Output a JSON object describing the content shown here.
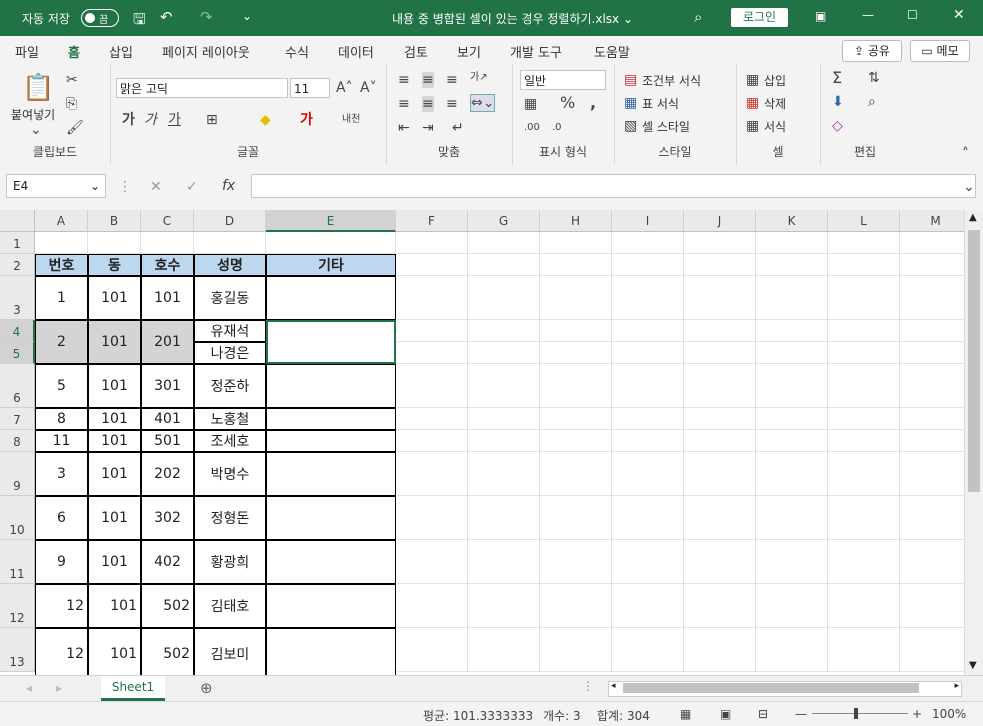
{
  "titlebar": {
    "autosave": "자동 저장",
    "toggle": "끔",
    "filename": "내용 중 병합된 셀이 있는 경우 정렬하기.xlsx",
    "login": "로그인"
  },
  "tabs": [
    "파일",
    "홈",
    "삽입",
    "페이지 레이아웃",
    "수식",
    "데이터",
    "검토",
    "보기",
    "개발 도구",
    "도움말"
  ],
  "share": "공유",
  "memo": "메모",
  "ribbon": {
    "clipboard": {
      "paste": "붙여넣기",
      "label": "클립보드"
    },
    "font": {
      "name": "맑은 고딕",
      "size": "11",
      "label": "글꼴"
    },
    "align": {
      "label": "맞춤"
    },
    "number": {
      "format": "일반",
      "label": "표시 형식"
    },
    "styles": {
      "cond": "조건부 서식",
      "table": "표 서식",
      "cell": "셀 스타일",
      "label": "스타일"
    },
    "cells": {
      "insert": "삽입",
      "delete": "삭제",
      "format": "서식",
      "label": "셀"
    },
    "edit": {
      "label": "편집"
    }
  },
  "namebox": "E4",
  "columns": [
    "A",
    "B",
    "C",
    "D",
    "E",
    "F",
    "G",
    "H",
    "I",
    "J",
    "K",
    "L",
    "M"
  ],
  "rows": [
    "1",
    "2",
    "3",
    "4",
    "5",
    "6",
    "7",
    "8",
    "9",
    "10",
    "11",
    "12",
    "13"
  ],
  "table": {
    "headers": [
      "번호",
      "동",
      "호수",
      "성명",
      "기타"
    ],
    "data": [
      [
        "1",
        "101",
        "101",
        "홍길동"
      ],
      [
        "2",
        "101",
        "201",
        "유재석"
      ],
      [
        "",
        "",
        "",
        "나경은"
      ],
      [
        "5",
        "101",
        "301",
        "정준하"
      ],
      [
        "8",
        "101",
        "401",
        "노홍철"
      ],
      [
        "11",
        "101",
        "501",
        "조세호"
      ],
      [
        "3",
        "101",
        "202",
        "박명수"
      ],
      [
        "6",
        "101",
        "302",
        "정형돈"
      ],
      [
        "9",
        "101",
        "402",
        "황광희"
      ],
      [
        "12",
        "101",
        "502",
        "김태호"
      ],
      [
        "12",
        "101",
        "502",
        "김보미"
      ]
    ]
  },
  "sheet": "Sheet1",
  "status": {
    "avg": "평균: 101.3333333",
    "count": "개수: 3",
    "sum": "합계: 304",
    "zoom": "100%"
  }
}
